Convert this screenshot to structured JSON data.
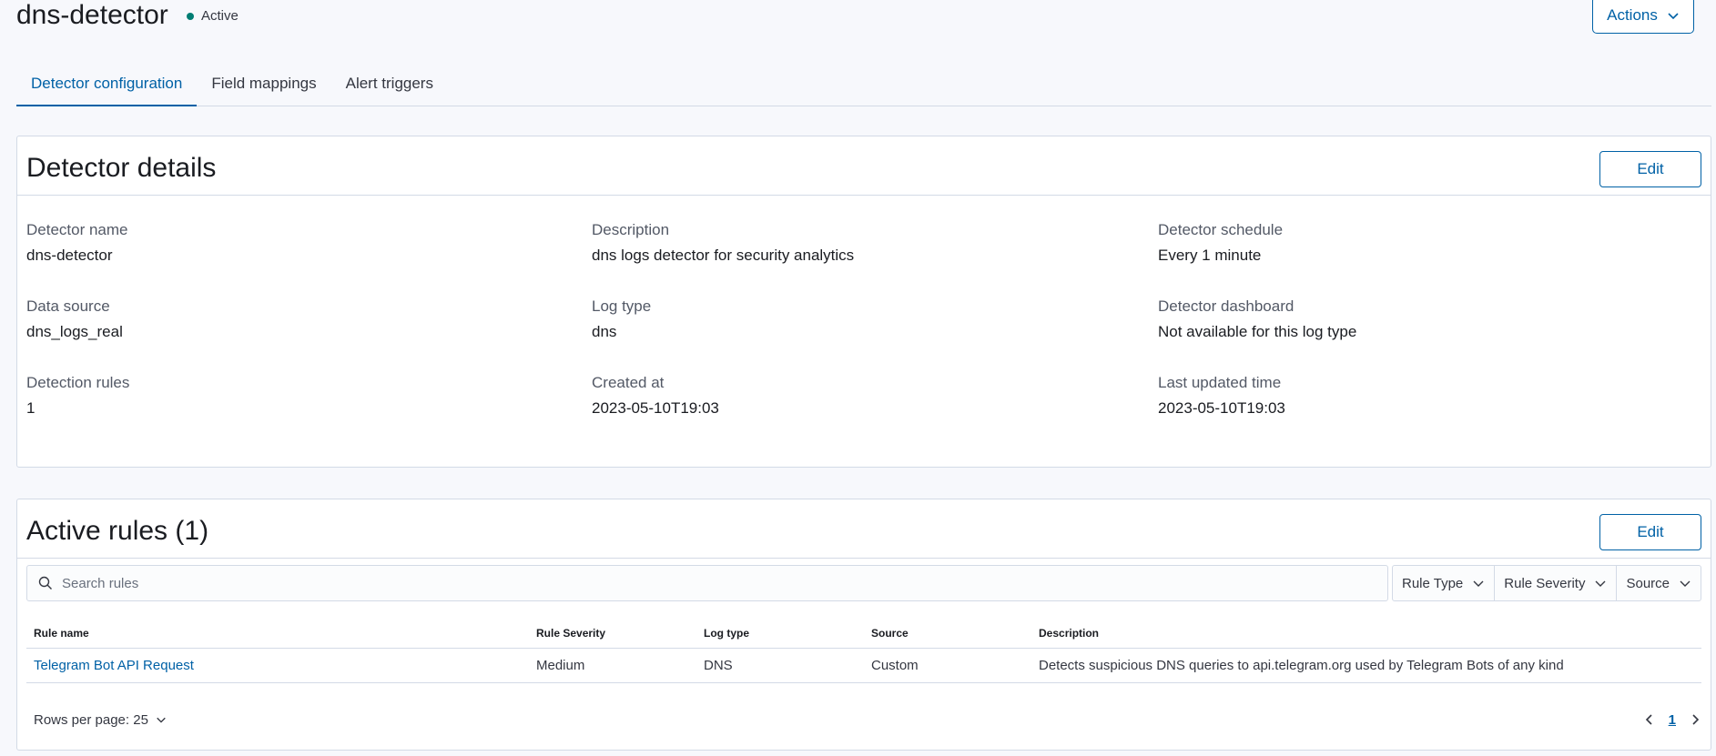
{
  "header": {
    "title": "dns-detector",
    "status": "Active",
    "actions_label": "Actions"
  },
  "tabs": [
    {
      "label": "Detector configuration",
      "active": true
    },
    {
      "label": "Field mappings",
      "active": false
    },
    {
      "label": "Alert triggers",
      "active": false
    }
  ],
  "details": {
    "title": "Detector details",
    "edit_label": "Edit",
    "fields": {
      "detector_name": {
        "label": "Detector name",
        "value": "dns-detector"
      },
      "description": {
        "label": "Description",
        "value": "dns logs detector for security analytics"
      },
      "schedule": {
        "label": "Detector schedule",
        "value": "Every 1 minute"
      },
      "data_source": {
        "label": "Data source",
        "value": "dns_logs_real"
      },
      "log_type": {
        "label": "Log type",
        "value": "dns"
      },
      "dashboard": {
        "label": "Detector dashboard",
        "value": "Not available for this log type"
      },
      "detection_rules": {
        "label": "Detection rules",
        "value": "1"
      },
      "created_at": {
        "label": "Created at",
        "value": "2023-05-10T19:03"
      },
      "last_updated": {
        "label": "Last updated time",
        "value": "2023-05-10T19:03"
      }
    }
  },
  "rules": {
    "title": "Active rules (1)",
    "edit_label": "Edit",
    "search_placeholder": "Search rules",
    "filters": [
      "Rule Type",
      "Rule Severity",
      "Source"
    ],
    "columns": [
      "Rule name",
      "Rule Severity",
      "Log type",
      "Source",
      "Description"
    ],
    "rows": [
      {
        "name": "Telegram Bot API Request",
        "severity": "Medium",
        "log_type": "DNS",
        "source": "Custom",
        "description": "Detects suspicious DNS queries to api.telegram.org used by Telegram Bots of any kind"
      }
    ],
    "rows_per_page": "Rows per page: 25",
    "current_page": "1"
  },
  "colors": {
    "accent": "#0061a6",
    "status_active": "#017d73"
  }
}
